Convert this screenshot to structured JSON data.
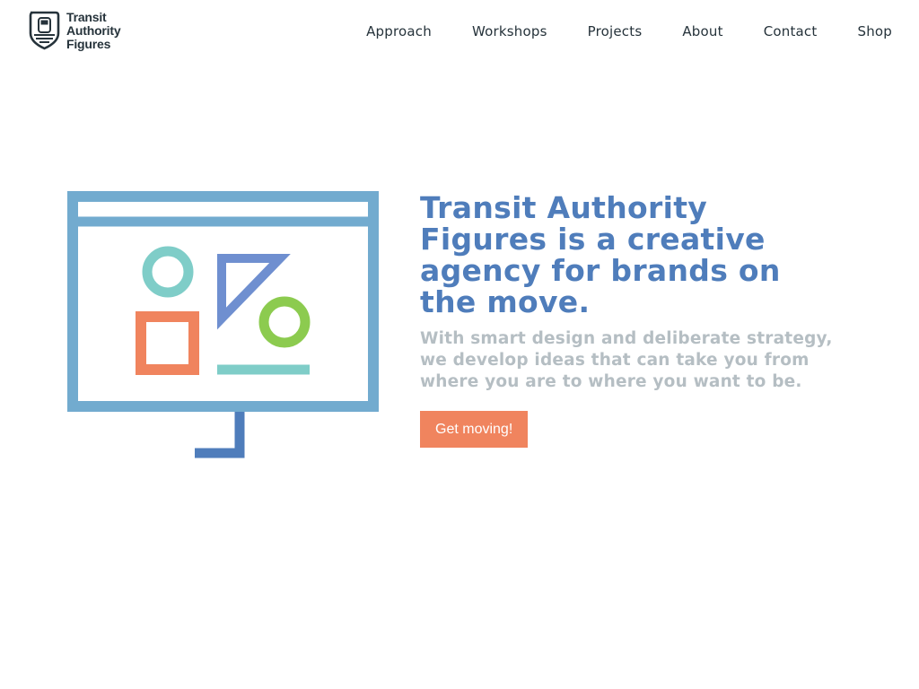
{
  "brand": {
    "logo_line1": "Transit",
    "logo_line2": "Authority",
    "logo_line3": "Figures"
  },
  "nav": {
    "items": [
      {
        "label": "Approach"
      },
      {
        "label": "Workshops"
      },
      {
        "label": "Projects"
      },
      {
        "label": "About"
      },
      {
        "label": "Contact"
      },
      {
        "label": "Shop"
      }
    ]
  },
  "hero": {
    "title": "Transit Authority Figures is a creative agency for brands on the move.",
    "subtitle": "With smart design and deliberate strategy, we develop ideas that can take you from where you are to where you want to be.",
    "cta_label": "Get moving!"
  },
  "colors": {
    "frame_blue": "#72abcf",
    "stand_blue": "#4f7dbb",
    "triangle_blue": "#6f8fd0",
    "teal": "#7fcdc8",
    "orange": "#f0845e",
    "green": "#8ccb4f",
    "title_blue": "#4f7dbb",
    "subtitle_gray": "#b5bec3",
    "text_dark": "#26333b"
  },
  "icons": {
    "logo": "shield-train-icon",
    "illustration": "screen-with-shapes-illustration"
  }
}
